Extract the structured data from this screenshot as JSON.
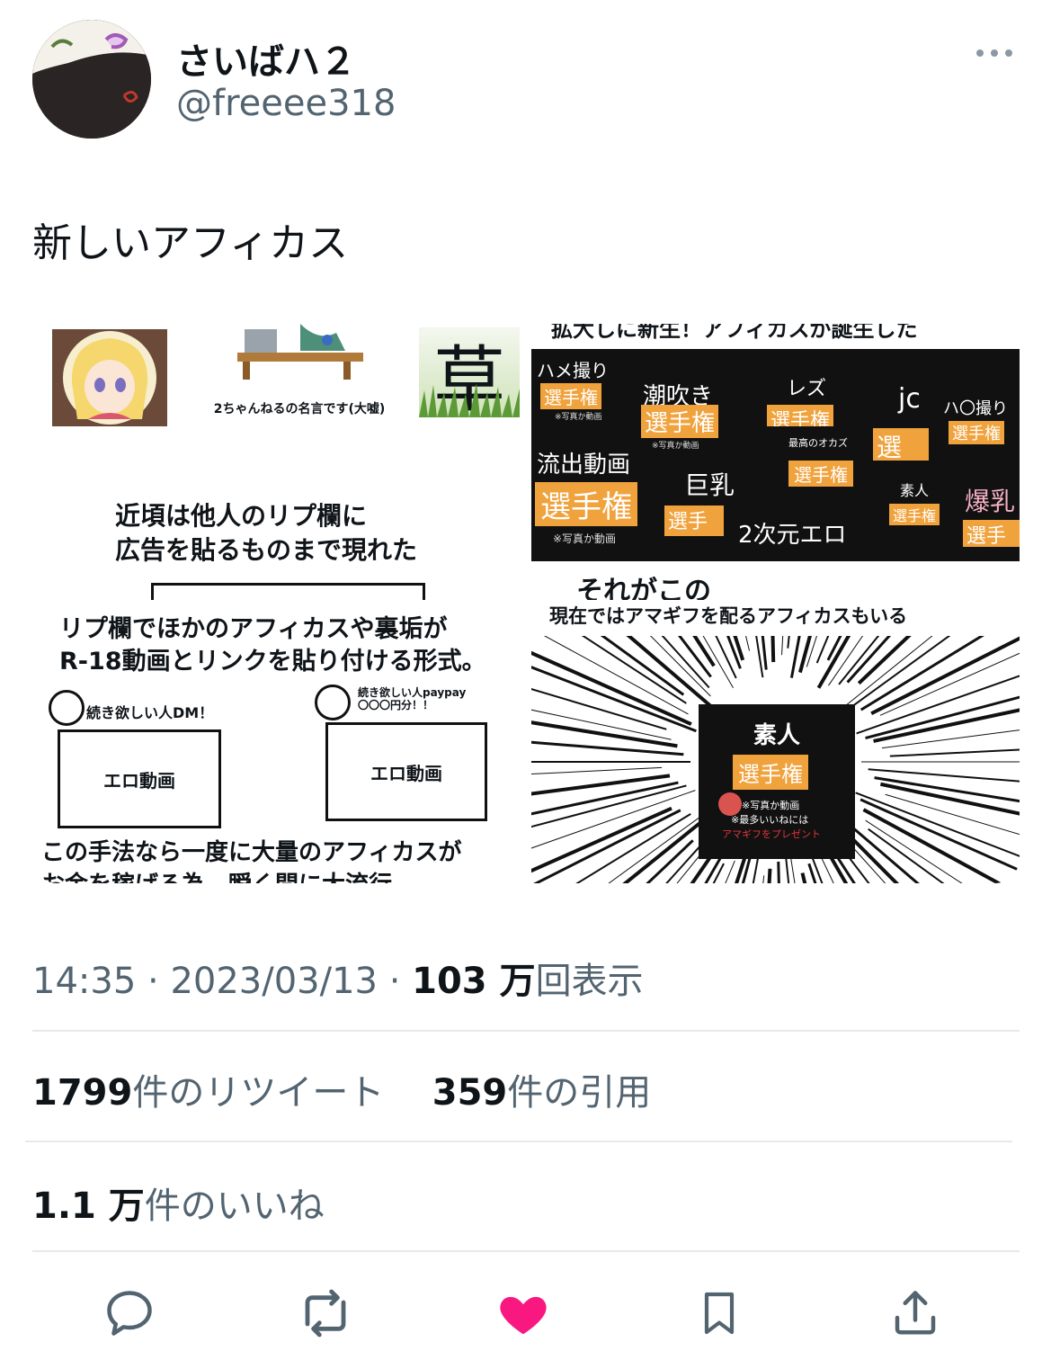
{
  "user": {
    "display_name": "さいばハ２",
    "handle": "@freeee318"
  },
  "tweet": {
    "text": "新しいアフィカス"
  },
  "media": {
    "panel1": {
      "caption_small": "2ちゃんねるの名言です(大嘘)",
      "kanji": "草",
      "line1": "近頃は他人のリプ欄に",
      "line2": "広告を貼るものまで現れた"
    },
    "panel2": {
      "top_cut": "拡大しに新生！アフィカスが誕生した",
      "tags": [
        "ハメ撮り",
        "潮吹き",
        "レズ",
        "jc",
        "ハ〇撮り",
        "流出動画",
        "巨乳",
        "2次元エロ",
        "素人",
        "爆乳"
      ],
      "badge": "選手権",
      "note_small": "※写真か動画",
      "note_best": "最高のオカズ",
      "bottom": "それがこの"
    },
    "panel3": {
      "line1": "リプ欄でほかのアフィカスや裏垢が",
      "line2": "R-18動画とリンクを貼り付ける形式。",
      "reply1_text": "続き欲しい人DM！",
      "reply2_text_a": "続き欲しい人paypay",
      "reply2_text_b": "〇〇〇円分！！",
      "box_label": "エロ動画",
      "bottom1": "この手法なら一度に大量のアフィカスが",
      "bottom2": "お金を稼げる為、瞬く間に大流行"
    },
    "panel4": {
      "top": "現在ではアマギフを配るアフィカスもいる",
      "title": "素人",
      "badge": "選手権",
      "note1": "※写真か動画",
      "note2": "※最多いいねには",
      "note3": "アマギフをプレゼント"
    }
  },
  "meta": {
    "time": "14:35",
    "date": "2023/03/13",
    "views_count": "103 万",
    "views_label": "回表示"
  },
  "stats": {
    "retweets_count": "1799",
    "retweets_label": "件のリツイート",
    "quotes_count": "359",
    "quotes_label": "件の引用",
    "likes_count": "1.1 万",
    "likes_label": "件のいいね"
  },
  "colors": {
    "accent_like": "#f91880",
    "text_secondary": "#536471",
    "badge_orange": "#f0a23c"
  },
  "icons": [
    "reply-icon",
    "retweet-icon",
    "like-icon",
    "bookmark-icon",
    "share-icon",
    "more-icon"
  ]
}
